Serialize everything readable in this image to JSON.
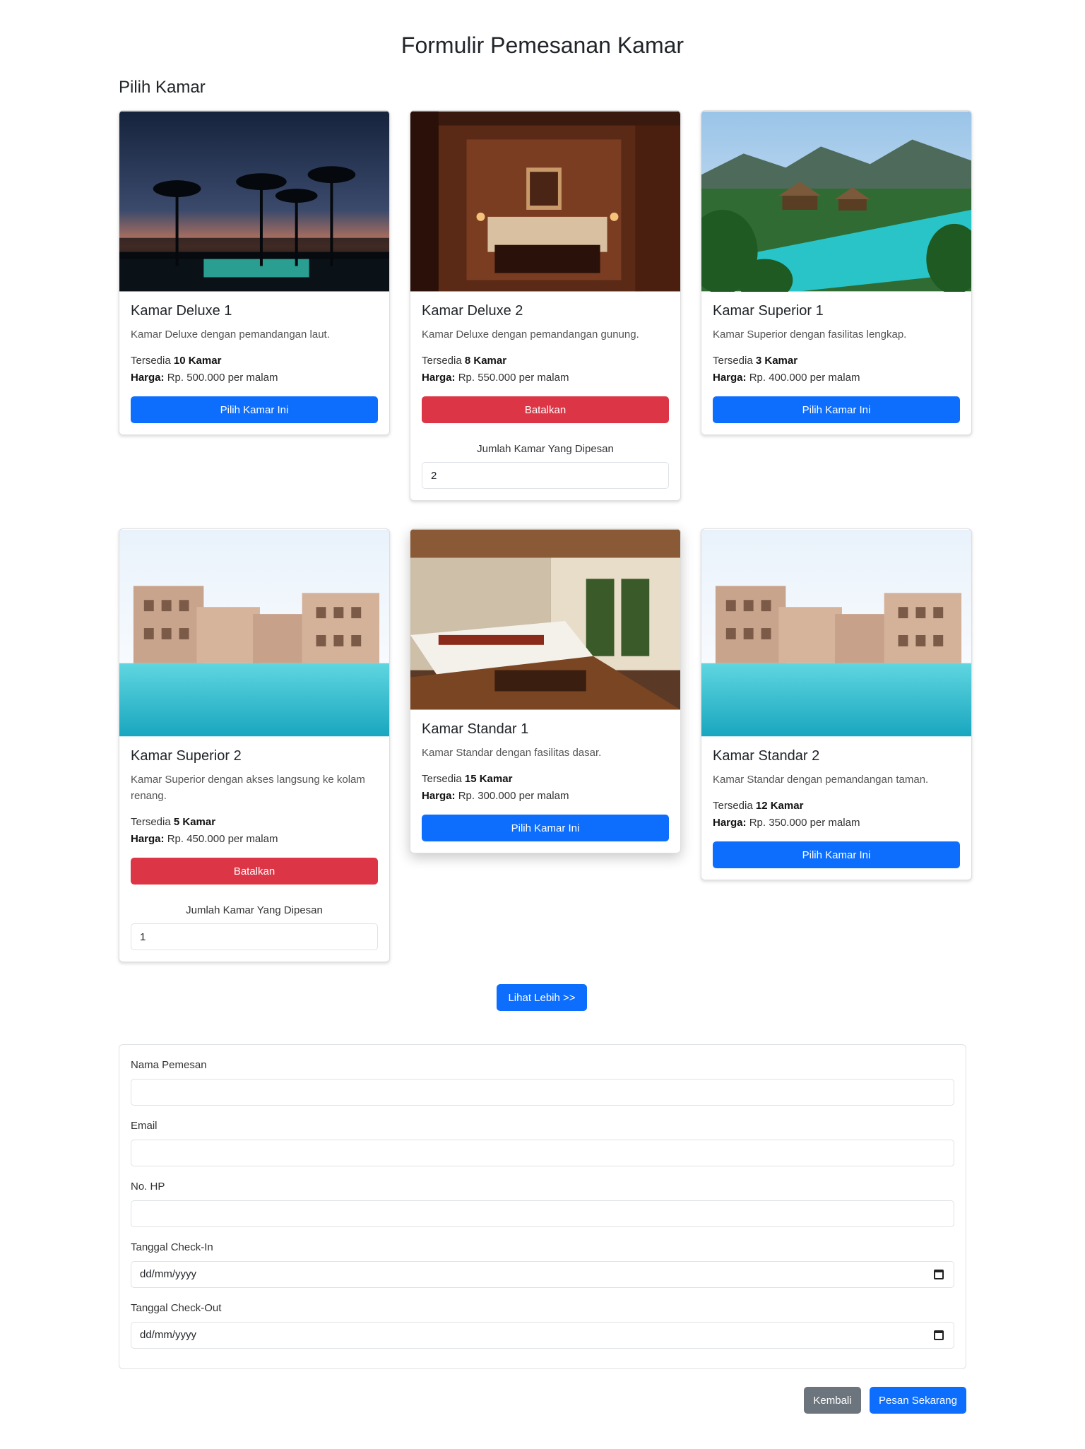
{
  "page": {
    "title": "Formulir Pemesanan Kamar",
    "section_title": "Pilih Kamar"
  },
  "rooms": [
    {
      "name": "Kamar Deluxe 1",
      "description": "Kamar Deluxe dengan pemandangan laut.",
      "available_prefix": "Tersedia",
      "available": "10 Kamar",
      "price_label": "Harga:",
      "price": "Rp. 500.000 per malam",
      "button": "Pilih Kamar Ini",
      "selected": false
    },
    {
      "name": "Kamar Deluxe 2",
      "description": "Kamar Deluxe dengan pemandangan gunung.",
      "available_prefix": "Tersedia",
      "available": "8 Kamar",
      "price_label": "Harga:",
      "price": "Rp. 550.000 per malam",
      "button": "Batalkan",
      "selected": true,
      "qty_label": "Jumlah Kamar Yang Dipesan",
      "qty": "2"
    },
    {
      "name": "Kamar Superior 1",
      "description": "Kamar Superior dengan fasilitas lengkap.",
      "available_prefix": "Tersedia",
      "available": "3 Kamar",
      "price_label": "Harga:",
      "price": "Rp. 400.000 per malam",
      "button": "Pilih Kamar Ini",
      "selected": false
    },
    {
      "name": "Kamar Superior 2",
      "description": "Kamar Superior dengan akses langsung ke kolam renang.",
      "available_prefix": "Tersedia",
      "available": "5 Kamar",
      "price_label": "Harga:",
      "price": "Rp. 450.000 per malam",
      "button": "Batalkan",
      "selected": true,
      "qty_label": "Jumlah Kamar Yang Dipesan",
      "qty": "1"
    },
    {
      "name": "Kamar Standar 1",
      "description": "Kamar Standar dengan fasilitas dasar.",
      "available_prefix": "Tersedia",
      "available": "15 Kamar",
      "price_label": "Harga:",
      "price": "Rp. 300.000 per malam",
      "button": "Pilih Kamar Ini",
      "selected": false
    },
    {
      "name": "Kamar Standar 2",
      "description": "Kamar Standar dengan pemandangan taman.",
      "available_prefix": "Tersedia",
      "available": "12 Kamar",
      "price_label": "Harga:",
      "price": "Rp. 350.000 per malam",
      "button": "Pilih Kamar Ini",
      "selected": false
    }
  ],
  "more_button": "Lihat Lebih >>",
  "form": {
    "name_label": "Nama Pemesan",
    "email_label": "Email",
    "phone_label": "No. HP",
    "checkin_label": "Tanggal Check-In",
    "checkin_placeholder": "dd/mm/yyyy",
    "checkout_label": "Tanggal Check-Out",
    "checkout_placeholder": "dd/mm/yyyy"
  },
  "actions": {
    "back": "Kembali",
    "submit": "Pesan Sekarang"
  },
  "colors": {
    "primary": "#0d6efd",
    "danger": "#dc3545",
    "secondary": "#6c757d"
  }
}
